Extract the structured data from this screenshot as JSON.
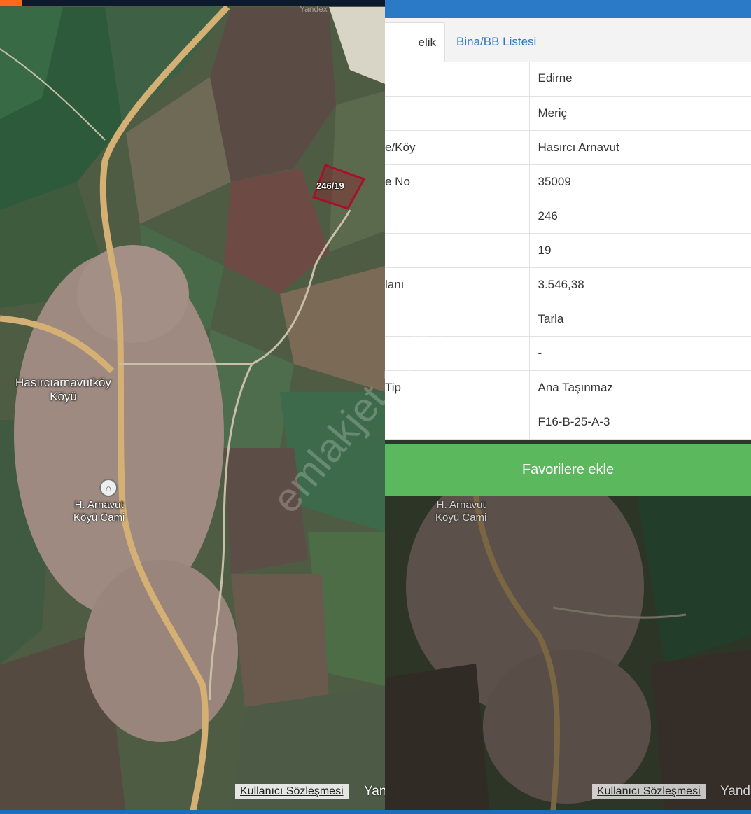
{
  "map": {
    "top_logo": "Yandex",
    "parcel_label": "246/19",
    "village_label_line1": "Hasırcıarnavutköy",
    "village_label_line2": "Köyü",
    "mosque_label_line1": "H. Arnavut",
    "mosque_label_line2": "Köyü Cami",
    "user_agreement": "Kullanıcı Sözleşmesi",
    "yandex_left": "Yan",
    "yandex_right": "Yand"
  },
  "tabs": [
    {
      "label": "elik Bilgisi",
      "active": true
    },
    {
      "label": "Bina/BB Listesi",
      "active": false
    }
  ],
  "rows": [
    {
      "label": "",
      "value": "Edirne"
    },
    {
      "label": "",
      "value": "Meriç"
    },
    {
      "label": "e/Köy",
      "value": "Hasırcı Arnavut"
    },
    {
      "label": "e No",
      "value": "35009"
    },
    {
      "label": "",
      "value": "246"
    },
    {
      "label": "",
      "value": "19"
    },
    {
      "label": "lanı",
      "value": "3.546,38"
    },
    {
      "label": "",
      "value": "Tarla"
    },
    {
      "label": "",
      "value": "-"
    },
    {
      "label": "Tip",
      "value": "Ana Taşınmaz"
    },
    {
      "label": "",
      "value": "F16-B-25-A-3"
    }
  ],
  "favorite_button": "Favorilere ekle",
  "watermark": "emlakjet.com",
  "colors": {
    "accent_blue": "#2a7ac8",
    "button_green": "#5cb85c",
    "parcel_outline": "#a8102a"
  }
}
